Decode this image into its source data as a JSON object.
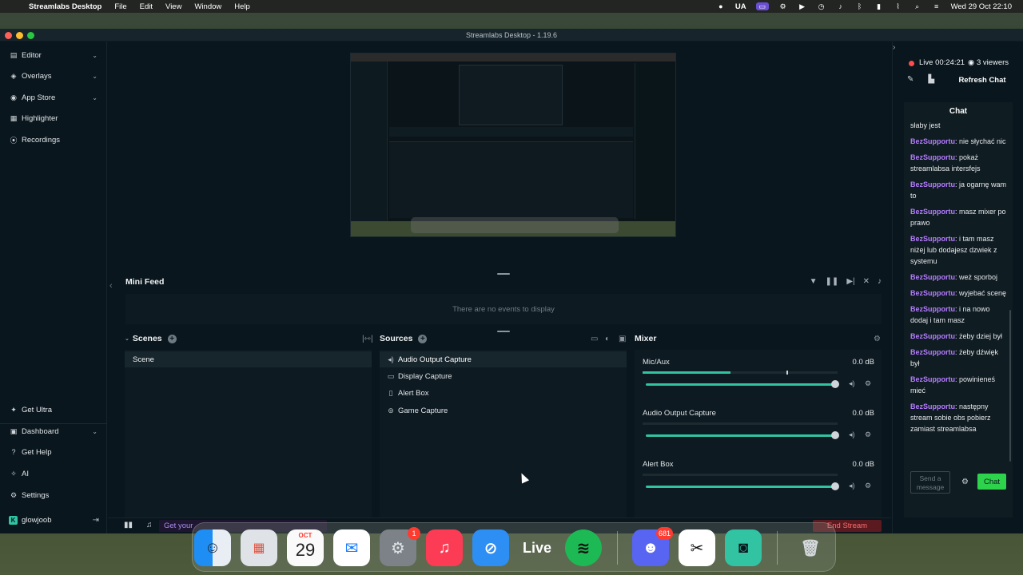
{
  "menubar": {
    "app_name": "Streamlabs Desktop",
    "menus": [
      "File",
      "Edit",
      "View",
      "Window",
      "Help"
    ],
    "input_source": "UA",
    "clock": "Wed 29 Oct  22:10"
  },
  "window": {
    "title": "Streamlabs Desktop - 1.19.6"
  },
  "sidebar": {
    "top_items": [
      {
        "label": "Editor",
        "icon": "editor-icon",
        "chevron": true
      },
      {
        "label": "Overlays",
        "icon": "overlays-icon",
        "chevron": true
      },
      {
        "label": "App Store",
        "icon": "app-store-icon",
        "chevron": true
      },
      {
        "label": "Highlighter",
        "icon": "highlighter-icon",
        "chevron": false
      },
      {
        "label": "Recordings",
        "icon": "recordings-icon",
        "chevron": false
      }
    ],
    "bottom_items": [
      {
        "label": "Get Ultra",
        "icon": "ultra-icon",
        "chevron": false
      },
      {
        "label": "Dashboard",
        "icon": "dashboard-icon",
        "chevron": true
      },
      {
        "label": "Get Help",
        "icon": "help-icon",
        "chevron": false
      },
      {
        "label": "AI",
        "icon": "ai-icon",
        "chevron": false
      },
      {
        "label": "Settings",
        "icon": "gear-icon",
        "chevron": false
      }
    ],
    "user": "glowjoob"
  },
  "mini_feed": {
    "title": "Mini Feed",
    "empty_text": "There are no events to display"
  },
  "scenes": {
    "title": "Scenes",
    "items": [
      "Scene"
    ]
  },
  "sources": {
    "title": "Sources",
    "items": [
      {
        "label": "Audio Output Capture",
        "icon": "speaker-icon"
      },
      {
        "label": "Display Capture",
        "icon": "monitor-icon"
      },
      {
        "label": "Alert Box",
        "icon": "alert-box-icon"
      },
      {
        "label": "Game Capture",
        "icon": "gamepad-icon"
      }
    ]
  },
  "mixer": {
    "title": "Mixer",
    "items": [
      {
        "name": "Mic/Aux",
        "db": "0.0 dB",
        "level": 0.45,
        "volume": 1.0
      },
      {
        "name": "Audio Output Capture",
        "db": "0.0 dB",
        "level": 0,
        "volume": 1.0
      },
      {
        "name": "Alert Box",
        "db": "0.0 dB",
        "level": 0,
        "volume": 1.0
      }
    ]
  },
  "statusbar": {
    "promo_text": "Get your",
    "end_stream": "End Stream"
  },
  "chat_panel": {
    "live_label": "Live 00:24:21",
    "viewers": "3 viewers",
    "refresh_chat": "Refresh Chat",
    "chat_title": "Chat",
    "input_placeholder": "Send a message",
    "send_label": "Chat",
    "messages": [
      {
        "user": "",
        "text": "słaby jest"
      },
      {
        "user": "BezSupportu",
        "text": "nie słychać nic"
      },
      {
        "user": "BezSupportu",
        "text": "pokaż streamlabsa intersfejs"
      },
      {
        "user": "BezSupportu",
        "text": "ja ogarnę wam to"
      },
      {
        "user": "BezSupportu",
        "text": "masz mixer po prawo"
      },
      {
        "user": "BezSupportu",
        "text": "i tam masz niżej lub dodajesz dzwiek z systemu"
      },
      {
        "user": "BezSupportu",
        "text": "weż sporboj"
      },
      {
        "user": "BezSupportu",
        "text": "wyjebać scenę"
      },
      {
        "user": "BezSupportu",
        "text": "i na nowo dodaj i tam masz"
      },
      {
        "user": "BezSupportu",
        "text": "żeby dziej był"
      },
      {
        "user": "BezSupportu",
        "text": "żeby dźwięk był"
      },
      {
        "user": "BezSupportu",
        "text": "powinieneś mieć"
      },
      {
        "user": "BezSupportu",
        "text": "następny stream sobie obs pobierz zamiast streamlabsa"
      }
    ]
  },
  "dock": {
    "calendar_month": "OCT",
    "calendar_day": "29",
    "settings_badge": "1",
    "discord_badge": "681",
    "live_label": "Live"
  }
}
